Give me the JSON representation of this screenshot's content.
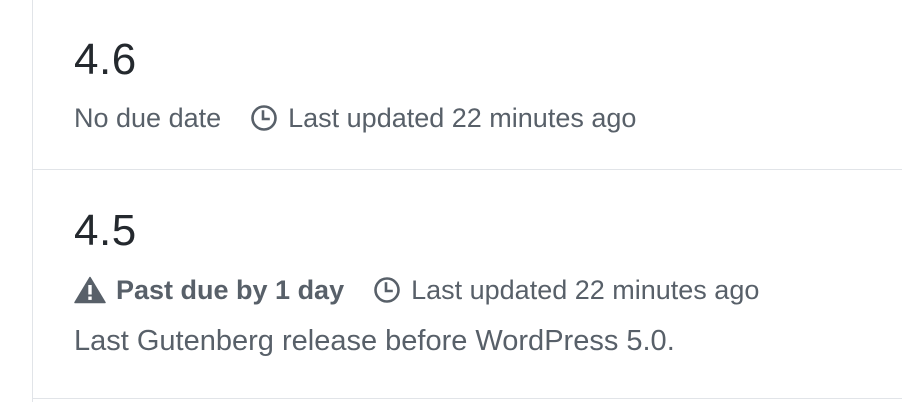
{
  "milestones": [
    {
      "title": "4.6",
      "due": "No due date",
      "updated": "Last updated 22 minutes ago",
      "description": ""
    },
    {
      "title": "4.5",
      "due": "Past due by 1 day",
      "updated": "Last updated 22 minutes ago",
      "description": "Last Gutenberg release before WordPress 5.0."
    }
  ],
  "icons": {
    "clock": "clock-icon",
    "warning": "alert-icon"
  },
  "colors": {
    "title": "#24292e",
    "meta": "#586069",
    "border": "#e1e4e8"
  }
}
